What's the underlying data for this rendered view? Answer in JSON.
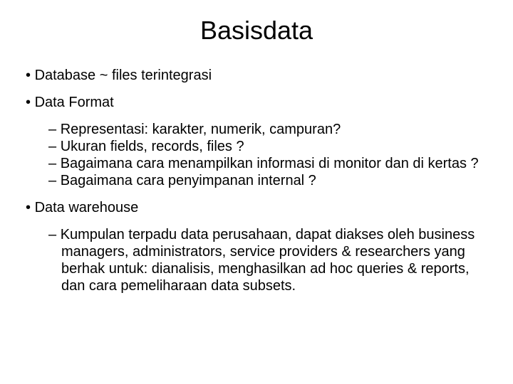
{
  "title": "Basisdata",
  "items": [
    {
      "level": 1,
      "text": "Database ~  files terintegrasi",
      "group_end": true
    },
    {
      "level": 1,
      "text": "Data Format"
    },
    {
      "level": 2,
      "text": "Representasi: karakter, numerik, campuran?"
    },
    {
      "level": 2,
      "text": "Ukuran fields, records, files ?"
    },
    {
      "level": 2,
      "text": "Bagaimana cara menampilkan informasi di monitor dan di kertas ?"
    },
    {
      "level": 2,
      "text": "Bagaimana cara penyimpanan internal ?",
      "group_end": true
    },
    {
      "level": 1,
      "text": "Data warehouse"
    },
    {
      "level": 2,
      "text": "Kumpulan terpadu data perusahaan, dapat diakses oleh business managers, administrators, service providers & researchers yang berhak untuk: dianalisis, menghasilkan ad hoc queries & reports, dan cara pemeliharaan data subsets."
    }
  ]
}
